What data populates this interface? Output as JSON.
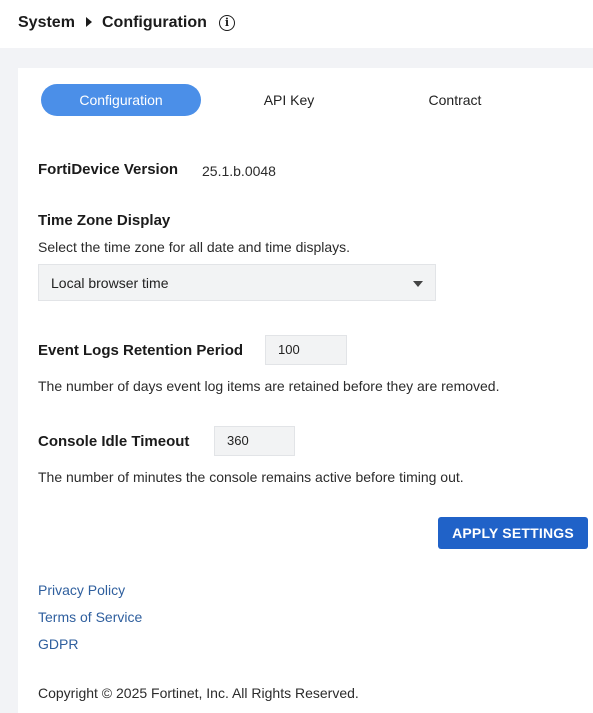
{
  "breadcrumb": {
    "root": "System",
    "current": "Configuration",
    "info_icon": "info-icon"
  },
  "tabs": [
    {
      "label": "Configuration",
      "active": true
    },
    {
      "label": "API Key",
      "active": false
    },
    {
      "label": "Contract",
      "active": false
    }
  ],
  "version": {
    "label": "FortiDevice Version",
    "value": "25.1.b.0048"
  },
  "timezone": {
    "title": "Time Zone Display",
    "description": "Select the time zone for all date and time displays.",
    "selected": "Local browser time",
    "caret_icon": "caret-down-icon"
  },
  "event_logs": {
    "label": "Event Logs Retention Period",
    "value": "100",
    "description": "The number of days event log items are retained before they are removed."
  },
  "idle_timeout": {
    "label": "Console Idle Timeout",
    "value": "360",
    "description": "The number of minutes the console remains active before timing out."
  },
  "apply_button": "APPLY SETTINGS",
  "links": {
    "privacy": "Privacy Policy",
    "terms": "Terms of Service",
    "gdpr": "GDPR"
  },
  "copyright": "Copyright © 2025 Fortinet, Inc. All Rights Reserved.",
  "colors": {
    "accent": "#4b8fe8",
    "button": "#2062c8",
    "link": "#2f5f9e"
  }
}
